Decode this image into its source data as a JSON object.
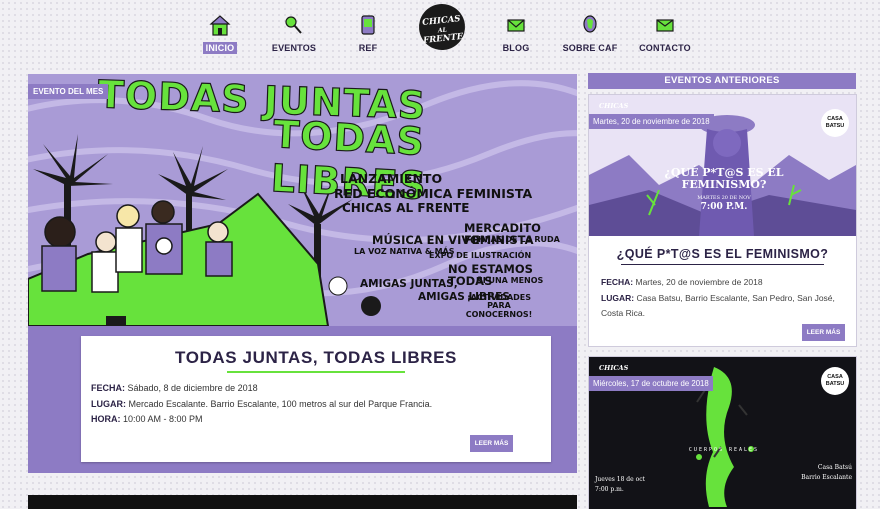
{
  "nav": {
    "items": [
      {
        "label": "INICIO",
        "icon": "house-icon",
        "active": true
      },
      {
        "label": "EVENTOS",
        "icon": "rattle-icon"
      },
      {
        "label": "REF",
        "icon": "phone-icon"
      },
      {
        "label": "BLOG",
        "icon": "envelope-icon"
      },
      {
        "label": "SOBRE CAF",
        "icon": "head-icon"
      },
      {
        "label": "CONTACTO",
        "icon": "mail-icon"
      }
    ],
    "logo_line1": "CHICAS",
    "logo_line2": "AL",
    "logo_line3": "FRENTE"
  },
  "main": {
    "tag": "EVENTO DEL MES",
    "poster": {
      "line1": "TODAS JUNTAS",
      "line2": "TODAS LIBRES",
      "lanzamiento": "LANZAMIENTO",
      "red": "RED ECONÓMICA FEMINISTA",
      "chicas": "CHICAS AL FRENTE",
      "mercadito": "MERCADITO FEMINISTA",
      "hijas": "HIJAS DE LA RUDA",
      "musica": "MÚSICA EN VIVO",
      "voz": "LA VOZ NATIVA & MÁS",
      "expo": "EXPO DE ILUSTRACIÓN",
      "no_estamos": "NO ESTAMOS TODAS",
      "ni_una": "NI UNA MENOS",
      "amigas": "AMIGAS JUNTAS,",
      "amigas2": "AMIGAS LIBRES",
      "actividades": "¡ACTIVIDADES PARA CONOCERNOS!"
    },
    "event": {
      "title": "TODAS JUNTAS, TODAS LIBRES",
      "fecha_label": "FECHA:",
      "fecha": "Sábado, 8 de diciembre de 2018",
      "lugar_label": "LUGAR:",
      "lugar": "Mercado Escalante. Barrio Escalante, 100 metros al sur del Parque Francia.",
      "hora_label": "HORA:",
      "hora": "10:00 AM - 8:00 PM",
      "button": "LEER MÁS"
    }
  },
  "sidebar": {
    "heading": "EVENTOS ANTERIORES",
    "events": [
      {
        "date": "Martes, 20 de noviembre de 2018",
        "poster_title": "¿QUÉ P*T@S ES EL FEMINISMO?",
        "poster_date": "MARTES 20 DE NOV",
        "poster_time": "7:00 P.M.",
        "seal": "CASA BATSU",
        "title": "¿QUÉ P*T@S ES EL FEMINISMO?",
        "fecha_label": "FECHA:",
        "fecha": "Martes, 20 de noviembre de 2018",
        "lugar_label": "LUGAR:",
        "lugar": "Casa Batsu, Barrio Escalante, San Pedro, San José, Costa Rica.",
        "button": "LEER MÁS"
      },
      {
        "date": "Miércoles, 17 de octubre de 2018",
        "poster_title": "CUERPOS REALES",
        "poster_left": "Jueves 18 de oct",
        "poster_left2": "7:00 p.m.",
        "poster_right": "Casa Batsú",
        "poster_right2": "Barrio Escalante",
        "seal": "CASA BATSU"
      }
    ]
  },
  "colors": {
    "accent": "#8d7bc4",
    "green": "#67e23c",
    "dark": "#2c2346"
  }
}
